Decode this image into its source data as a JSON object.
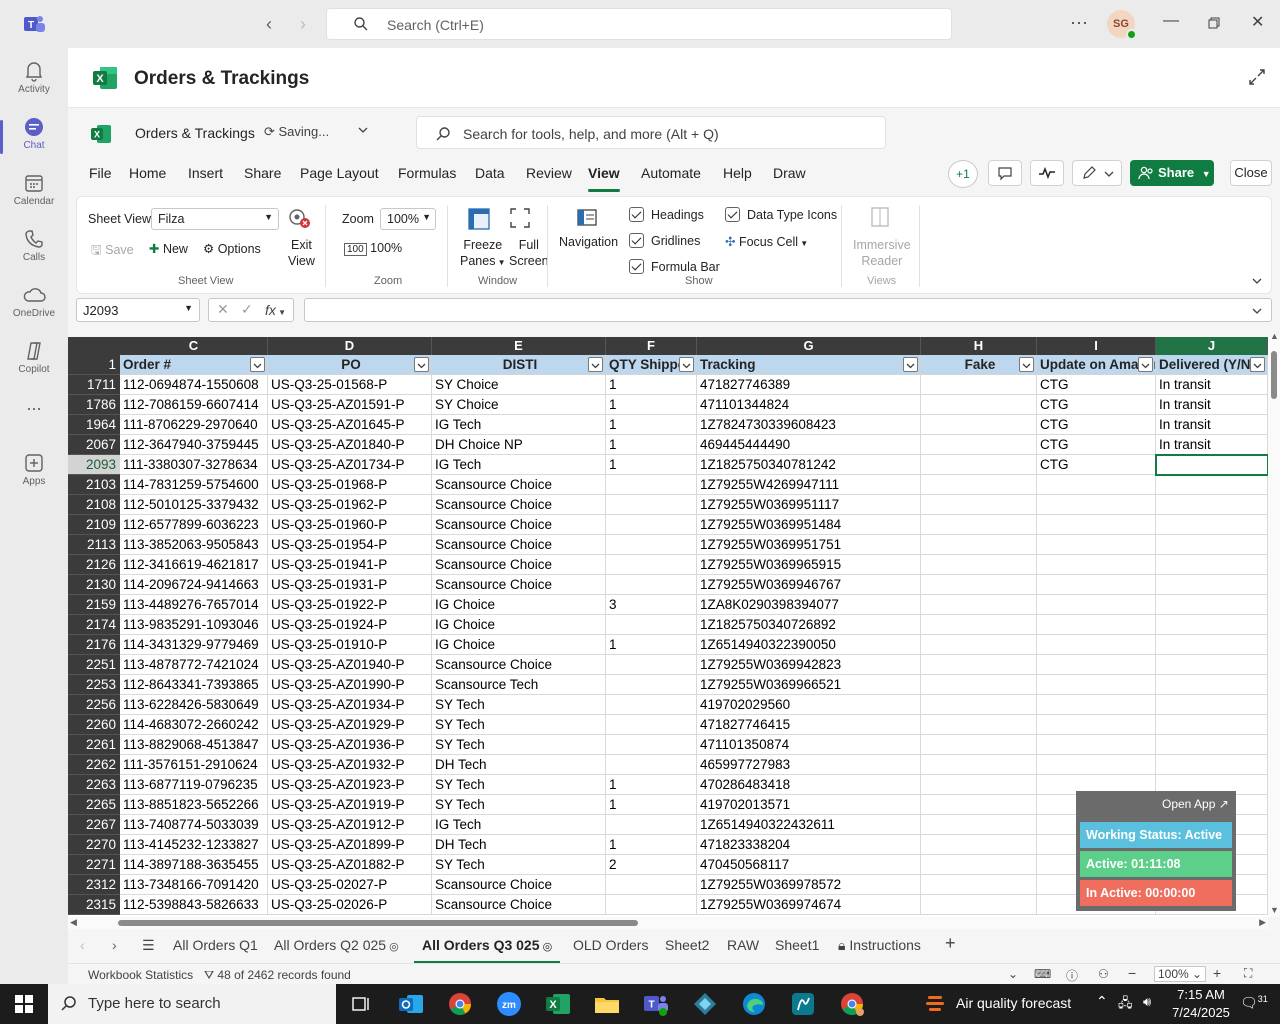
{
  "teams": {
    "search_placeholder": "Search (Ctrl+E)",
    "avatar_initials": "SG",
    "rail": [
      {
        "label": "Activity"
      },
      {
        "label": "Chat"
      },
      {
        "label": "Calendar"
      },
      {
        "label": "Calls"
      },
      {
        "label": "OneDrive"
      },
      {
        "label": "Copilot"
      },
      {
        "label": "..."
      },
      {
        "label": "Apps"
      }
    ]
  },
  "app": {
    "title": "Orders & Trackings",
    "workbook_name": "Orders & Trackings",
    "saving_status": "Saving...",
    "tools_search": "Search for tools, help, and more (Alt + Q)"
  },
  "menu": {
    "items": [
      "File",
      "Home",
      "Insert",
      "Share",
      "Page Layout",
      "Formulas",
      "Data",
      "Review",
      "View",
      "Automate",
      "Help",
      "Draw"
    ],
    "active": "View",
    "coauthor_count": "+1",
    "share_label": "Share",
    "close_label": "Close"
  },
  "ribbon": {
    "sheet_view_label": "Sheet View",
    "sheet_view_value": "Filza",
    "save": "Save",
    "new": "New",
    "options": "Options",
    "exit_view": [
      "Exit",
      "View"
    ],
    "group_sheet_view": "Sheet View",
    "zoom_label": "Zoom",
    "zoom_value": "100%",
    "zoom_100": "100%",
    "group_zoom": "Zoom",
    "freeze": [
      "Freeze",
      "Panes"
    ],
    "full_screen": [
      "Full",
      "Screen"
    ],
    "group_window": "Window",
    "navigation": "Navigation",
    "headings": "Headings",
    "gridlines": "Gridlines",
    "formula_bar": "Formula Bar",
    "data_type_icons": "Data Type Icons",
    "focus_cell": "Focus Cell",
    "group_show": "Show",
    "immersive": [
      "Immersive",
      "Reader"
    ],
    "group_views": "Views"
  },
  "formula": {
    "namebox": "J2093",
    "fx": "fx"
  },
  "grid": {
    "columns": [
      "C",
      "D",
      "E",
      "F",
      "G",
      "H",
      "I",
      "J"
    ],
    "header_row_num": "1",
    "headers": [
      "Order #",
      "PO",
      "DISTI",
      "QTY Shipped",
      "Tracking",
      "Fake",
      "Update on Amazon",
      "Delivered (Y/N)"
    ],
    "rows": [
      {
        "n": "1711",
        "c": [
          "112-0694874-1550608",
          "US-Q3-25-01568-P",
          "SY Choice",
          "1",
          "471827746389",
          "",
          "CTG",
          "In transit"
        ]
      },
      {
        "n": "1786",
        "c": [
          "112-7086159-6607414",
          "US-Q3-25-AZ01591-P",
          "SY Choice",
          "1",
          "471101344824",
          "",
          "CTG",
          "In transit"
        ]
      },
      {
        "n": "1964",
        "c": [
          "111-8706229-2970640",
          "US-Q3-25-AZ01645-P",
          "IG Tech",
          "1",
          "1Z7824730339608423",
          "",
          "CTG",
          "In transit"
        ]
      },
      {
        "n": "2067",
        "c": [
          "112-3647940-3759445",
          "US-Q3-25-AZ01840-P",
          "DH Choice NP",
          "1",
          "469445444490",
          "",
          "CTG",
          "In transit"
        ]
      },
      {
        "n": "2093",
        "c": [
          "111-3380307-3278634",
          "US-Q3-25-AZ01734-P",
          "IG Tech",
          "1",
          "1Z1825750340781242",
          "",
          "CTG",
          ""
        ]
      },
      {
        "n": "2103",
        "c": [
          "114-7831259-5754600",
          "US-Q3-25-01968-P",
          "Scansource Choice",
          "",
          "1Z79255W4269947111",
          "",
          "",
          ""
        ]
      },
      {
        "n": "2108",
        "c": [
          "112-5010125-3379432",
          "US-Q3-25-01962-P",
          "Scansource Choice",
          "",
          "1Z79255W0369951117",
          "",
          "",
          ""
        ]
      },
      {
        "n": "2109",
        "c": [
          "112-6577899-6036223",
          "US-Q3-25-01960-P",
          "Scansource Choice",
          "",
          "1Z79255W0369951484",
          "",
          "",
          ""
        ]
      },
      {
        "n": "2113",
        "c": [
          "113-3852063-9505843",
          "US-Q3-25-01954-P",
          "Scansource Choice",
          "",
          "1Z79255W0369951751",
          "",
          "",
          ""
        ]
      },
      {
        "n": "2126",
        "c": [
          "112-3416619-4621817",
          "US-Q3-25-01941-P",
          "Scansource Choice",
          "",
          "1Z79255W0369965915",
          "",
          "",
          ""
        ]
      },
      {
        "n": "2130",
        "c": [
          "114-2096724-9414663",
          "US-Q3-25-01931-P",
          "Scansource Choice",
          "",
          "1Z79255W0369946767",
          "",
          "",
          ""
        ]
      },
      {
        "n": "2159",
        "c": [
          "113-4489276-7657014",
          "US-Q3-25-01922-P",
          "IG Choice",
          "3",
          "1ZA8K0290398394077",
          "",
          "",
          ""
        ]
      },
      {
        "n": "2174",
        "c": [
          "113-9835291-1093046",
          "US-Q3-25-01924-P",
          "IG Choice",
          "",
          "1Z1825750340726892",
          "",
          "",
          ""
        ]
      },
      {
        "n": "2176",
        "c": [
          "114-3431329-9779469",
          "US-Q3-25-01910-P",
          "IG Choice",
          "1",
          "1Z6514940322390050",
          "",
          "",
          ""
        ]
      },
      {
        "n": "2251",
        "c": [
          "113-4878772-7421024",
          "US-Q3-25-AZ01940-P",
          "Scansource Choice",
          "",
          "1Z79255W0369942823",
          "",
          "",
          ""
        ]
      },
      {
        "n": "2253",
        "c": [
          "112-8643341-7393865",
          "US-Q3-25-AZ01990-P",
          "Scansource Tech",
          "",
          "1Z79255W0369966521",
          "",
          "",
          ""
        ]
      },
      {
        "n": "2256",
        "c": [
          "113-6228426-5830649",
          "US-Q3-25-AZ01934-P",
          "SY Tech",
          "",
          "419702029560",
          "",
          "",
          ""
        ]
      },
      {
        "n": "2260",
        "c": [
          "114-4683072-2660242",
          "US-Q3-25-AZ01929-P",
          "SY Tech",
          "",
          "471827746415",
          "",
          "",
          ""
        ]
      },
      {
        "n": "2261",
        "c": [
          "113-8829068-4513847",
          "US-Q3-25-AZ01936-P",
          "SY Tech",
          "",
          "471101350874",
          "",
          "",
          ""
        ]
      },
      {
        "n": "2262",
        "c": [
          "111-3576151-2910624",
          "US-Q3-25-AZ01932-P",
          "DH Tech",
          "",
          "465997727983",
          "",
          "",
          ""
        ]
      },
      {
        "n": "2263",
        "c": [
          "113-6877119-0796235",
          "US-Q3-25-AZ01923-P",
          "SY Tech",
          "1",
          "470286483418",
          "",
          "",
          ""
        ]
      },
      {
        "n": "2265",
        "c": [
          "113-8851823-5652266",
          "US-Q3-25-AZ01919-P",
          "SY Tech",
          "1",
          "419702013571",
          "",
          "",
          ""
        ]
      },
      {
        "n": "2267",
        "c": [
          "113-7408774-5033039",
          "US-Q3-25-AZ01912-P",
          "IG Tech",
          "",
          "1Z6514940322432611",
          "",
          "",
          ""
        ]
      },
      {
        "n": "2270",
        "c": [
          "113-4145232-1233827",
          "US-Q3-25-AZ01899-P",
          "DH Tech",
          "1",
          "471823338204",
          "",
          "",
          ""
        ]
      },
      {
        "n": "2271",
        "c": [
          "114-3897188-3635455",
          "US-Q3-25-AZ01882-P",
          "SY Tech",
          "2",
          "470450568117",
          "",
          "",
          ""
        ]
      },
      {
        "n": "2312",
        "c": [
          "113-7348166-7091420",
          "US-Q3-25-02027-P",
          "Scansource Choice",
          "",
          "1Z79255W0369978572",
          "",
          "",
          ""
        ]
      },
      {
        "n": "2315",
        "c": [
          "112-5398843-5826633",
          "US-Q3-25-02026-P",
          "Scansource Choice",
          "",
          "1Z79255W0369974674",
          "",
          "",
          ""
        ]
      }
    ]
  },
  "sheets": {
    "tabs": [
      "All Orders Q1",
      "All Orders Q2 025",
      "All Orders Q3 025",
      "OLD Orders",
      "Sheet2",
      "RAW",
      "Sheet1",
      "Instructions"
    ],
    "active": "All Orders Q3 025"
  },
  "status": {
    "workbook_stats": "Workbook Statistics",
    "records": "48 of 2462 records found",
    "zoom": "100%"
  },
  "widget": {
    "open_app": "Open App ↗",
    "working": "Working Status: Active",
    "active": "Active: 01:11:08",
    "inactive": "In Active: 00:00:00",
    "colors": {
      "working": "#5bc0de",
      "active": "#5cd08a",
      "inactive": "#f06e5e"
    }
  },
  "taskbar": {
    "search": "Type here to search",
    "weather": "Air quality forecast",
    "time": "7:15 AM",
    "date": "7/24/2025",
    "notif": "31"
  },
  "colors": {
    "excel_green": "#107c41",
    "teams_purple": "#5b5fc7",
    "header_fill": "#bdd7ee"
  }
}
